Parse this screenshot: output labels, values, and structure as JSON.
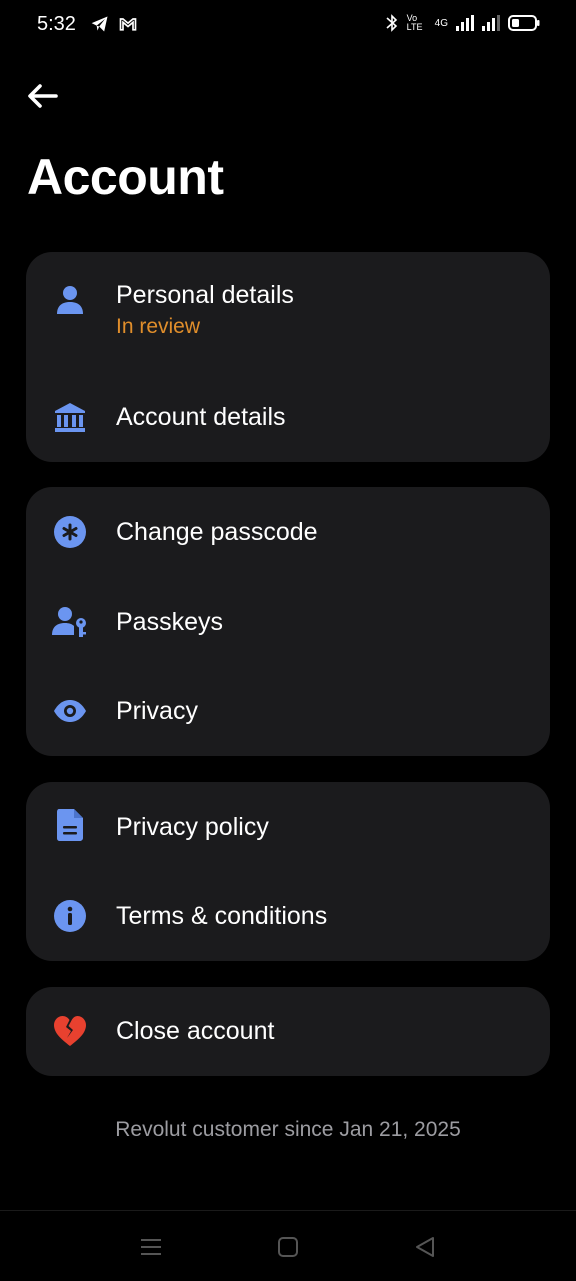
{
  "status": {
    "time": "5:32",
    "network_label": "4G",
    "volte_label": "Vo LTE"
  },
  "header": {
    "title": "Account"
  },
  "groups": [
    {
      "items": [
        {
          "label": "Personal details",
          "sublabel": "In review",
          "icon": "person-icon"
        },
        {
          "label": "Account details",
          "icon": "bank-icon"
        }
      ]
    },
    {
      "items": [
        {
          "label": "Change passcode",
          "icon": "asterisk-icon"
        },
        {
          "label": "Passkeys",
          "icon": "passkey-icon"
        },
        {
          "label": "Privacy",
          "icon": "eye-icon"
        }
      ]
    },
    {
      "items": [
        {
          "label": "Privacy policy",
          "icon": "document-icon"
        },
        {
          "label": "Terms & conditions",
          "icon": "info-icon"
        }
      ]
    },
    {
      "items": [
        {
          "label": "Close account",
          "icon": "broken-heart-icon"
        }
      ]
    }
  ],
  "footer": {
    "note": "Revolut customer since Jan 21, 2025"
  },
  "colors": {
    "accent_blue": "#6b95f0",
    "warning_orange": "#e08e2b",
    "danger_red": "#e8412f",
    "card_bg": "#1b1b1d"
  }
}
